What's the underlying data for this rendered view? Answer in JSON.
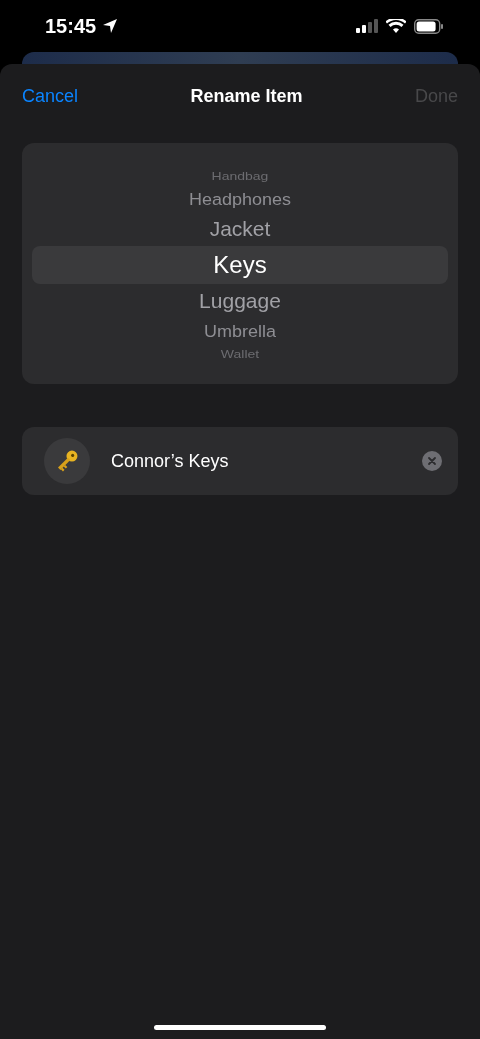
{
  "status_bar": {
    "time": "15:45"
  },
  "nav": {
    "cancel": "Cancel",
    "title": "Rename Item",
    "done": "Done",
    "done_disabled": true
  },
  "picker": {
    "items": [
      {
        "label": "Handbag",
        "selected": false
      },
      {
        "label": "Headphones",
        "selected": false
      },
      {
        "label": "Jacket",
        "selected": false
      },
      {
        "label": "Keys",
        "selected": true
      },
      {
        "label": "Luggage",
        "selected": false
      },
      {
        "label": "Umbrella",
        "selected": false
      },
      {
        "label": "Wallet",
        "selected": false
      }
    ]
  },
  "name_field": {
    "value": "Connor’s Keys"
  }
}
